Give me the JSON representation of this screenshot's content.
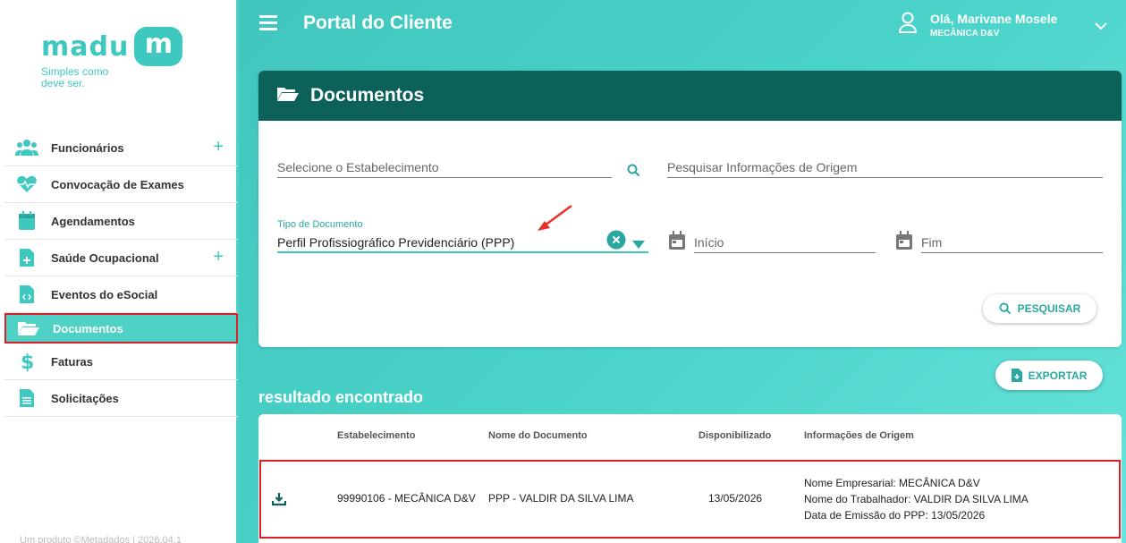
{
  "sidebar": {
    "logo_word": "madu",
    "logo_badge": "m",
    "logo_tagline": "Simples como deve ser.",
    "items": [
      {
        "label": "Funcionários",
        "icon": "users-icon",
        "plus": "+"
      },
      {
        "label": "Convocação de Exames",
        "icon": "heart-pulse-icon"
      },
      {
        "label": "Agendamentos",
        "icon": "calendar-icon"
      },
      {
        "label": "Saúde Ocupacional",
        "icon": "medical-file-icon",
        "plus": "+"
      },
      {
        "label": "Eventos do eSocial",
        "icon": "code-file-icon"
      },
      {
        "label": "Documentos",
        "icon": "folder-open-icon",
        "active": true
      },
      {
        "label": "Faturas",
        "icon": "dollar-icon"
      },
      {
        "label": "Solicitações",
        "icon": "document-icon"
      }
    ],
    "footer": "Um produto ©Metadados | 2026.04.1"
  },
  "header": {
    "title": "Portal do Cliente",
    "greeting": "Olá, Marivane Mosele",
    "company": "MECÂNICA D&V"
  },
  "card": {
    "title": "Documentos",
    "establishment_placeholder": "Selecione o Estabelecimento",
    "origin_placeholder": "Pesquisar Informações de Origem",
    "doc_type_label": "Tipo de Documento",
    "doc_type_value": "Perfil Profissiográfico Previdenciário (PPP)",
    "start_placeholder": "Início",
    "end_placeholder": "Fim",
    "search_button": "PESQUISAR"
  },
  "export_button": "EXPORTAR",
  "result_title": "resultado encontrado",
  "table": {
    "columns": [
      "Estabelecimento",
      "Nome do Documento",
      "Disponibilizado",
      "Informações de Origem"
    ],
    "rows": [
      {
        "establishment": "99990106 - MECÂNICA D&V",
        "document": "PPP - VALDIR DA SILVA LIMA",
        "available": "13/05/2026",
        "origin": [
          "Nome Empresarial: MECÂNICA D&V",
          "Nome do Trabalhador: VALDIR DA SILVA LIMA",
          "Data de Emissão do PPP: 13/05/2026"
        ]
      }
    ]
  },
  "colors": {
    "accent": "#3ec8c0",
    "header_dark": "#0c6159",
    "highlight": "#d9202a"
  }
}
